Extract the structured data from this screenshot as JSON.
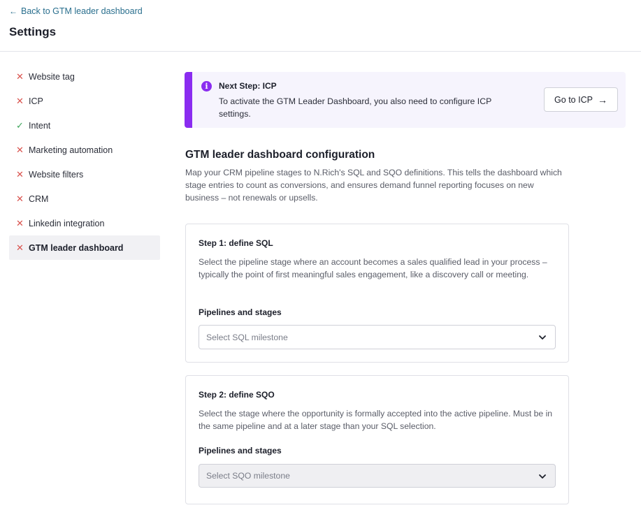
{
  "header": {
    "back_link": "Back to GTM leader dashboard",
    "title": "Settings"
  },
  "sidebar": {
    "items": [
      {
        "label": "Website tag",
        "status": "x"
      },
      {
        "label": "ICP",
        "status": "x"
      },
      {
        "label": "Intent",
        "status": "check"
      },
      {
        "label": "Marketing automation",
        "status": "x"
      },
      {
        "label": "Website filters",
        "status": "x"
      },
      {
        "label": "CRM",
        "status": "x"
      },
      {
        "label": "Linkedin integration",
        "status": "x"
      },
      {
        "label": "GTM leader dashboard",
        "status": "x",
        "active": true
      }
    ]
  },
  "banner": {
    "icon": "info-icon",
    "title": "Next Step: ICP",
    "text": "To activate the GTM Leader Dashboard, you also need to configure ICP settings.",
    "button_label": "Go to ICP",
    "accent": "#8a2cf0"
  },
  "config": {
    "title": "GTM leader dashboard configuration",
    "description": "Map your CRM pipeline stages to N.Rich's SQL and SQO definitions. This tells the dashboard which stage entries to count as conversions, and ensures demand funnel reporting focuses on new business – not renewals or upsells."
  },
  "step1": {
    "title": "Step 1: define SQL",
    "description": "Select the pipeline stage where an account becomes a sales qualified lead in your process – typically the point of first meaningful sales engagement, like a discovery call or meeting.",
    "field_label": "Pipelines and stages",
    "placeholder": "Select SQL milestone"
  },
  "step2": {
    "title": "Step 2: define SQO",
    "description": "Select the stage where the opportunity is formally accepted into the active pipeline. Must be in the same pipeline and at a later stage than your SQL selection.",
    "field_label": "Pipelines and stages",
    "placeholder": "Select SQO milestone",
    "disabled": true
  }
}
